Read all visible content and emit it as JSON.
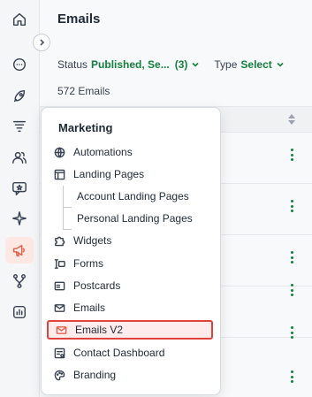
{
  "sidebar": {
    "icons": [
      "home-icon",
      "chat-icon",
      "rocket-icon",
      "funnel-icon",
      "people-icon",
      "feedback-icon",
      "sparkle-icon",
      "megaphone-icon",
      "branch-icon",
      "chart-icon"
    ],
    "active": "megaphone-icon",
    "accent": "#e2614d"
  },
  "header": {
    "title": "Emails"
  },
  "filters": {
    "status_label": "Status",
    "status_value": "Published, Se...",
    "status_count": "(3)",
    "type_label": "Type",
    "type_value": "Select"
  },
  "count_text": "572 Emails",
  "menu": {
    "title": "Marketing",
    "items": [
      {
        "label": "Automations",
        "icon": "globe-icon"
      },
      {
        "label": "Landing Pages",
        "icon": "layout-icon"
      },
      {
        "label": "Account Landing Pages",
        "icon": ""
      },
      {
        "label": "Personal Landing Pages",
        "icon": ""
      },
      {
        "label": "Widgets",
        "icon": "puzzle-icon"
      },
      {
        "label": "Forms",
        "icon": "form-icon"
      },
      {
        "label": "Postcards",
        "icon": "postcard-icon"
      },
      {
        "label": "Emails",
        "icon": "mail-icon"
      },
      {
        "label": "Emails V2",
        "icon": "mail-icon"
      },
      {
        "label": "Contact Dashboard",
        "icon": "dashboard-icon"
      },
      {
        "label": "Branding",
        "icon": "palette-icon"
      }
    ],
    "highlighted": "Emails V2"
  },
  "colors": {
    "green": "#15803d",
    "highlight_border": "#e0413a"
  }
}
